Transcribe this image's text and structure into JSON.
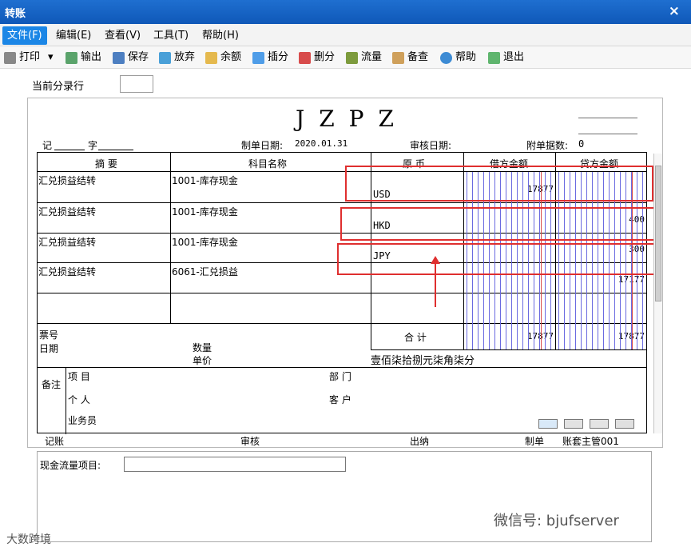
{
  "window": {
    "title": "转账",
    "close": "×"
  },
  "menu": [
    {
      "label": "文件(F)"
    },
    {
      "label": "编辑(E)"
    },
    {
      "label": "查看(V)"
    },
    {
      "label": "工具(T)"
    },
    {
      "label": "帮助(H)"
    }
  ],
  "toolbar": [
    {
      "label": "打印",
      "icon": "printer-icon"
    },
    {
      "label": "输出",
      "icon": "export-icon"
    },
    {
      "label": "保存",
      "icon": "save-icon"
    },
    {
      "label": "放弃",
      "icon": "discard-icon"
    },
    {
      "label": "余额",
      "icon": "balance-icon"
    },
    {
      "label": "插分",
      "icon": "insert-icon"
    },
    {
      "label": "删分",
      "icon": "delete-icon"
    },
    {
      "label": "流量",
      "icon": "flow-icon"
    },
    {
      "label": "备查",
      "icon": "memo-icon"
    },
    {
      "label": "帮助",
      "icon": "help-icon"
    },
    {
      "label": "退出",
      "icon": "exit-icon"
    }
  ],
  "current_entry_label": "当前分录行",
  "voucher": {
    "code": "JZPZ",
    "type_left": "记",
    "type_right": "字",
    "date_label": "制单日期:",
    "date": "2020.01.31",
    "audit_date_label": "审核日期:",
    "attachments_label": "附单据数:",
    "attachments": "0"
  },
  "headers": {
    "summary": "摘 要",
    "account": "科目名称",
    "currency": "原 币",
    "debit": "借方金额",
    "credit": "贷方金额"
  },
  "rows": [
    {
      "summary": "汇兑损益结转",
      "account": "1001-库存现金",
      "currency": "USD",
      "debit": "17877",
      "credit": ""
    },
    {
      "summary": "汇兑损益结转",
      "account": "1001-库存现金",
      "currency": "HKD",
      "debit": "",
      "credit": "400"
    },
    {
      "summary": "汇兑损益结转",
      "account": "1001-库存现金",
      "currency": "JPY",
      "debit": "",
      "credit": "300"
    },
    {
      "summary": "汇兑损益结转",
      "account": "6061-汇兑损益",
      "currency": "",
      "debit": "",
      "credit": "17177"
    }
  ],
  "totals": {
    "ticket": "票号",
    "date": "日期",
    "quantity": "数量",
    "unit_price": "单价",
    "total_label": "合 计",
    "debit": "17877",
    "credit": "17877",
    "amount_words": "壹佰柒拾捌元柒角柒分"
  },
  "remarks": {
    "label": "备注",
    "project": "项 目",
    "personal": "个 人",
    "salesman": "业务员",
    "department": "部 门",
    "customer": "客 户"
  },
  "footer": {
    "bookkeeping": "记账",
    "audit": "审核",
    "cashier": "出纳",
    "maker": "制单",
    "maker_name": "账套主管001"
  },
  "cashflow_label": "现金流量项目:",
  "watermarks": {
    "left": "大数跨境",
    "right": "微信号: bjufserver"
  },
  "colors": {
    "title_blue": "#1463c6",
    "menu_active": "#1b86e6",
    "highlight_red": "#df2f2f",
    "grid_blue": "#6a6ae0"
  }
}
